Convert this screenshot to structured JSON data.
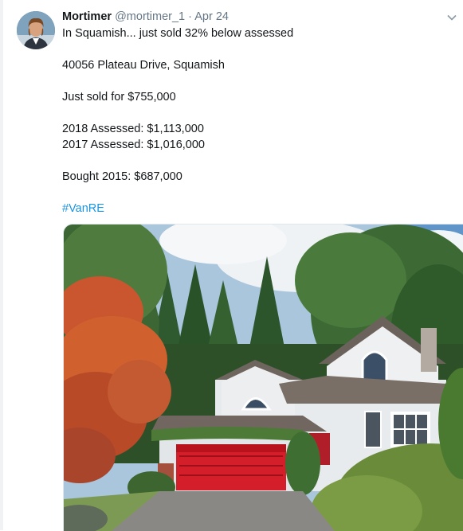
{
  "tweet": {
    "author_name": "Mortimer",
    "author_handle": "@mortimer_1",
    "separator": "·",
    "date": "Apr 24",
    "menu_icon": "chevron-down-icon",
    "lines": [
      "In Squamish... just sold 32% below assessed",
      "",
      "40056 Plateau Drive, Squamish",
      "",
      "Just sold for $755,000",
      "",
      "2018 Assessed: $1,113,000",
      "2017 Assessed: $1,016,000",
      "",
      "Bought 2015: $687,000",
      ""
    ],
    "hashtag": "#VanRE",
    "hashtag_color": "#1b95e0",
    "media": {
      "type": "photo",
      "subject": "house-photo"
    }
  }
}
